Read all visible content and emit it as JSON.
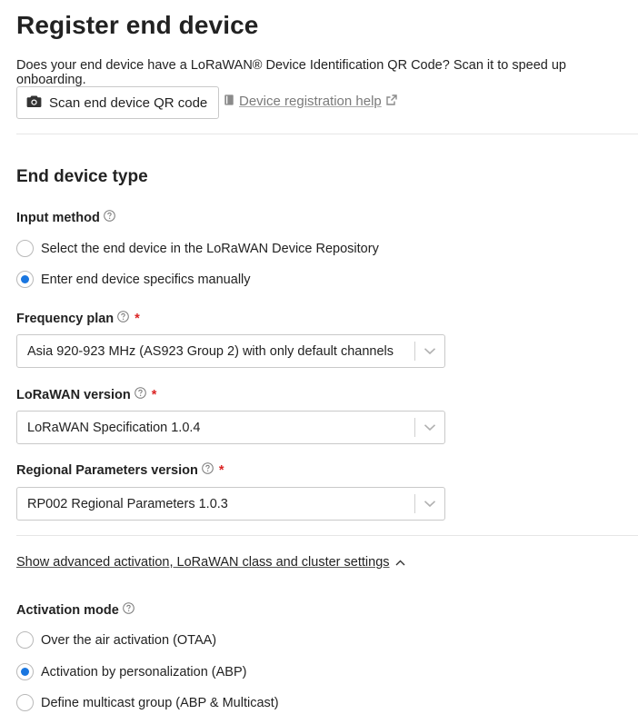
{
  "header": {
    "title": "Register end device",
    "intro": "Does your end device have a LoRaWAN® Device Identification QR Code? Scan it to speed up onboarding.",
    "scan_button": "Scan end device QR code",
    "help_link": "Device registration help"
  },
  "end_device_type": {
    "title": "End device type",
    "input_method": {
      "label": "Input method",
      "options": [
        {
          "label": "Select the end device in the LoRaWAN Device Repository",
          "selected": false
        },
        {
          "label": "Enter end device specifics manually",
          "selected": true
        }
      ]
    },
    "frequency_plan": {
      "label": "Frequency plan",
      "required_mark": "*",
      "value": "Asia 920-923 MHz (AS923 Group 2) with only default channels"
    },
    "lorawan_version": {
      "label": "LoRaWAN version",
      "required_mark": "*",
      "value": "LoRaWAN Specification 1.0.4"
    },
    "regional_parameters": {
      "label": "Regional Parameters version",
      "required_mark": "*",
      "value": "RP002 Regional Parameters 1.0.3"
    }
  },
  "advanced": {
    "toggle_label": "Show advanced activation, LoRaWAN class and cluster settings",
    "activation_mode": {
      "label": "Activation mode",
      "options": [
        {
          "label": "Over the air activation (OTAA)",
          "selected": false
        },
        {
          "label": "Activation by personalization (ABP)",
          "selected": true
        },
        {
          "label": "Define multicast group (ABP & Multicast)",
          "selected": false
        }
      ]
    }
  },
  "colors": {
    "accent": "#1976e0",
    "required": "#db2424",
    "border": "#c9c9c9"
  }
}
